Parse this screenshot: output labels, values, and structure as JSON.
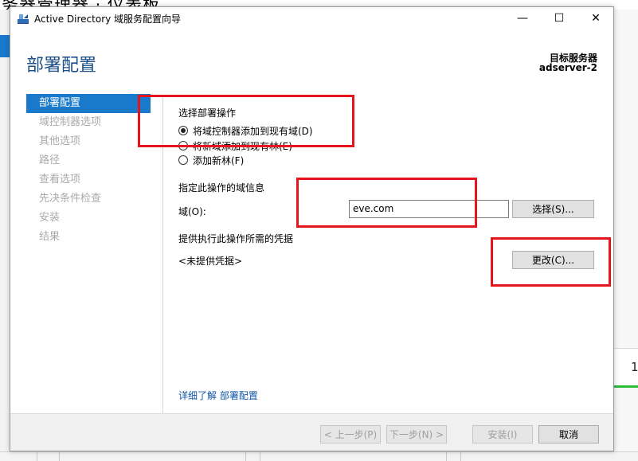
{
  "background": {
    "top_text": "务器管理器 · 仪表板",
    "right_number": "1"
  },
  "window": {
    "title": "Active Directory 域服务配置向导",
    "controls": {
      "minimize": "—",
      "maximize": "☐",
      "close": "✕"
    }
  },
  "header": {
    "page_title": "部署配置",
    "target_server_label": "目标服务器",
    "target_server_value": "adserver-2"
  },
  "nav": {
    "items": [
      {
        "label": "部署配置",
        "active": true
      },
      {
        "label": "域控制器选项",
        "active": false
      },
      {
        "label": "其他选项",
        "active": false
      },
      {
        "label": "路径",
        "active": false
      },
      {
        "label": "查看选项",
        "active": false
      },
      {
        "label": "先决条件检查",
        "active": false
      },
      {
        "label": "安装",
        "active": false
      },
      {
        "label": "结果",
        "active": false
      }
    ]
  },
  "deployment": {
    "section_label": "选择部署操作",
    "options": [
      {
        "label": "将域控制器添加到现有域(D)",
        "selected": true
      },
      {
        "label": "将新域添加到现有林(E)",
        "selected": false
      },
      {
        "label": "添加新林(F)",
        "selected": false
      }
    ]
  },
  "domain_info": {
    "section_label": "指定此操作的域信息",
    "domain_label": "域(O):",
    "domain_value": "eve.com",
    "select_button": "选择(S)..."
  },
  "credentials": {
    "section_label": "提供执行此操作所需的凭据",
    "value": "<未提供凭据>",
    "change_button": "更改(C)..."
  },
  "more_link": "详细了解 部署配置",
  "footer": {
    "prev": "< 上一步(P)",
    "next": "下一步(N) >",
    "install": "安装(I)",
    "cancel": "取消"
  },
  "colors": {
    "accent": "#1979ca",
    "title": "#1c4f8a",
    "annotation": "#e8141b",
    "link": "#0f55a6"
  }
}
